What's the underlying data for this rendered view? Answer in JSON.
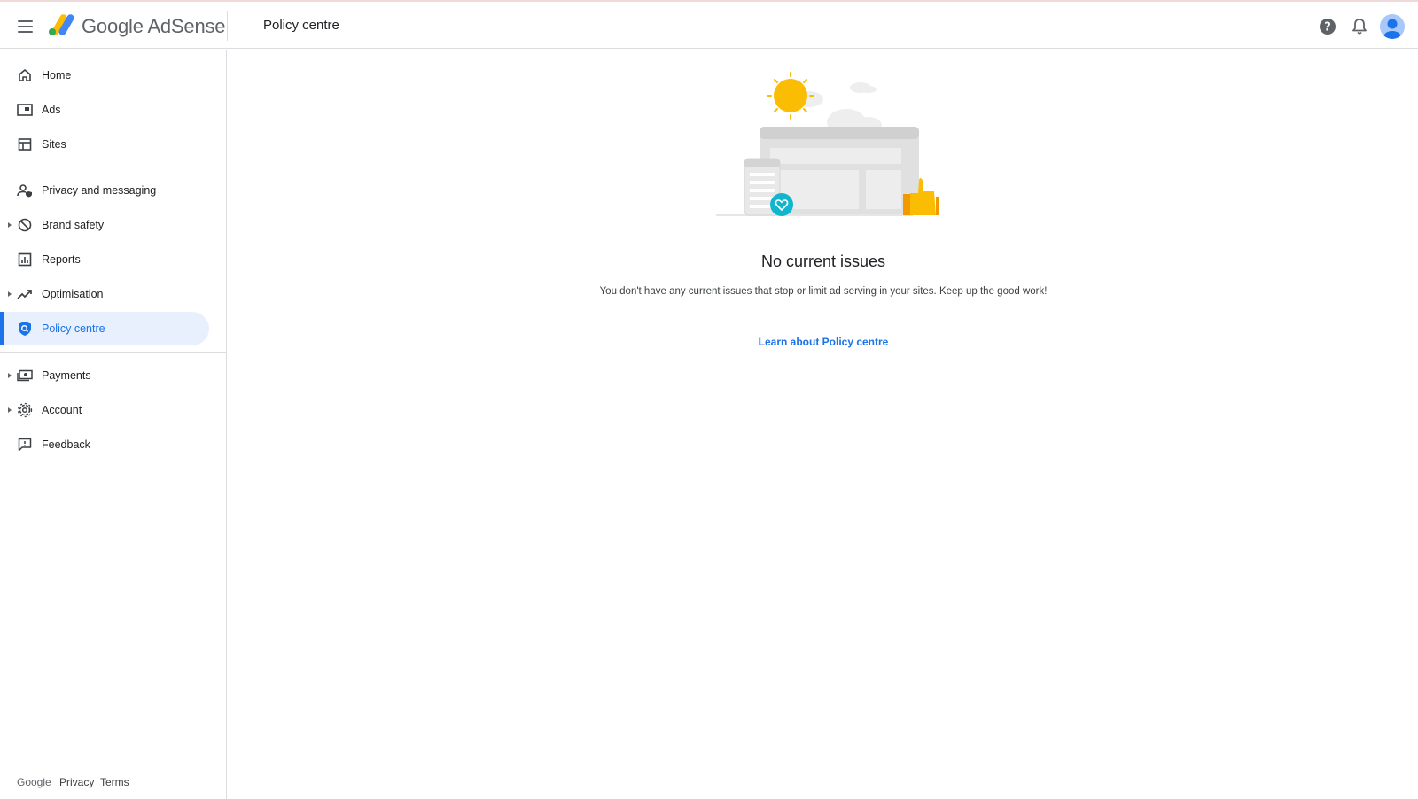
{
  "header": {
    "brand": "Google AdSense",
    "page_title": "Policy centre"
  },
  "sidebar": {
    "items": [
      {
        "label": "Home",
        "icon": "home-icon"
      },
      {
        "label": "Ads",
        "icon": "ads-icon"
      },
      {
        "label": "Sites",
        "icon": "sites-icon"
      },
      {
        "label": "Privacy and messaging",
        "icon": "privacy-icon"
      },
      {
        "label": "Brand safety",
        "icon": "brand-safety-icon",
        "expandable": true
      },
      {
        "label": "Reports",
        "icon": "reports-icon"
      },
      {
        "label": "Optimisation",
        "icon": "optimisation-icon",
        "expandable": true
      },
      {
        "label": "Policy centre",
        "icon": "policy-centre-icon",
        "active": true
      },
      {
        "label": "Payments",
        "icon": "payments-icon",
        "expandable": true
      },
      {
        "label": "Account",
        "icon": "account-icon",
        "expandable": true
      },
      {
        "label": "Feedback",
        "icon": "feedback-icon"
      }
    ]
  },
  "footer": {
    "google": "Google",
    "privacy": "Privacy",
    "terms": "Terms"
  },
  "main": {
    "heading": "No current issues",
    "description": "You don't have any current issues that stop or limit ad serving in your sites. Keep up the good work!",
    "link": "Learn about Policy centre"
  },
  "colors": {
    "accent": "#1a73e8",
    "active_bg": "#e8f0fe",
    "sun": "#fbbc04",
    "heart_badge": "#12b5cb"
  }
}
